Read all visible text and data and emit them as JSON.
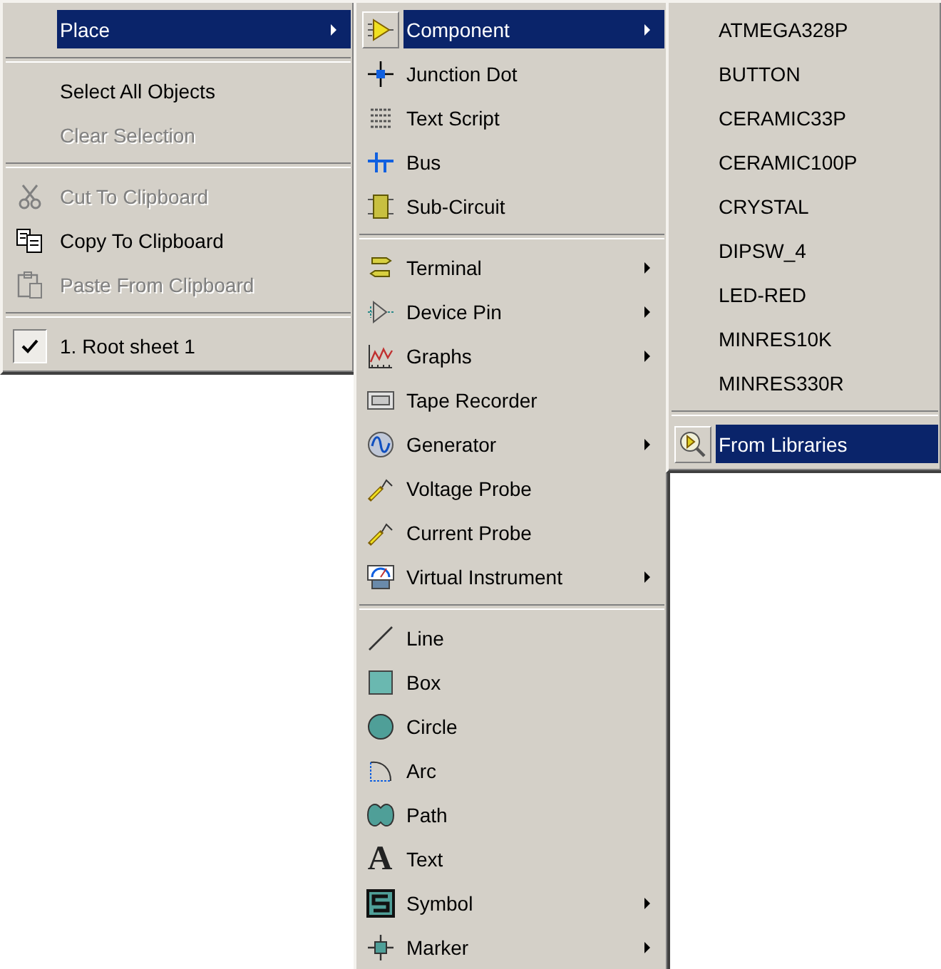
{
  "menus": [
    {
      "items": [
        {
          "kind": "item",
          "label": "Place",
          "selected": true,
          "disabled": false,
          "submenu": true
        },
        {
          "kind": "separator"
        },
        {
          "kind": "item",
          "label": "Select All Objects",
          "selected": false,
          "disabled": false,
          "submenu": false
        },
        {
          "kind": "item",
          "label": "Clear Selection",
          "selected": false,
          "disabled": true,
          "submenu": false
        },
        {
          "kind": "separator"
        },
        {
          "kind": "item",
          "label": "Cut To Clipboard",
          "selected": false,
          "disabled": true,
          "submenu": false
        },
        {
          "kind": "item",
          "label": "Copy To Clipboard",
          "selected": false,
          "disabled": false,
          "submenu": false
        },
        {
          "kind": "item",
          "label": "Paste From Clipboard",
          "selected": false,
          "disabled": true,
          "submenu": false
        },
        {
          "kind": "separator"
        },
        {
          "kind": "item",
          "label": "1. Root sheet 1",
          "selected": false,
          "disabled": false,
          "submenu": false,
          "checked": true
        }
      ]
    },
    {
      "items": [
        {
          "kind": "item",
          "label": "Component",
          "selected": true,
          "disabled": false,
          "submenu": true
        },
        {
          "kind": "item",
          "label": "Junction Dot",
          "selected": false,
          "disabled": false,
          "submenu": false
        },
        {
          "kind": "item",
          "label": "Text Script",
          "selected": false,
          "disabled": false,
          "submenu": false
        },
        {
          "kind": "item",
          "label": "Bus",
          "selected": false,
          "disabled": false,
          "submenu": false
        },
        {
          "kind": "item",
          "label": "Sub-Circuit",
          "selected": false,
          "disabled": false,
          "submenu": false
        },
        {
          "kind": "separator"
        },
        {
          "kind": "item",
          "label": "Terminal",
          "selected": false,
          "disabled": false,
          "submenu": true
        },
        {
          "kind": "item",
          "label": "Device Pin",
          "selected": false,
          "disabled": false,
          "submenu": true
        },
        {
          "kind": "item",
          "label": "Graphs",
          "selected": false,
          "disabled": false,
          "submenu": true
        },
        {
          "kind": "item",
          "label": "Tape Recorder",
          "selected": false,
          "disabled": false,
          "submenu": false
        },
        {
          "kind": "item",
          "label": "Generator",
          "selected": false,
          "disabled": false,
          "submenu": true
        },
        {
          "kind": "item",
          "label": "Voltage Probe",
          "selected": false,
          "disabled": false,
          "submenu": false
        },
        {
          "kind": "item",
          "label": "Current Probe",
          "selected": false,
          "disabled": false,
          "submenu": false
        },
        {
          "kind": "item",
          "label": "Virtual Instrument",
          "selected": false,
          "disabled": false,
          "submenu": true
        },
        {
          "kind": "separator"
        },
        {
          "kind": "item",
          "label": "Line",
          "selected": false,
          "disabled": false,
          "submenu": false
        },
        {
          "kind": "item",
          "label": "Box",
          "selected": false,
          "disabled": false,
          "submenu": false
        },
        {
          "kind": "item",
          "label": "Circle",
          "selected": false,
          "disabled": false,
          "submenu": false
        },
        {
          "kind": "item",
          "label": "Arc",
          "selected": false,
          "disabled": false,
          "submenu": false
        },
        {
          "kind": "item",
          "label": "Path",
          "selected": false,
          "disabled": false,
          "submenu": false
        },
        {
          "kind": "item",
          "label": "Text",
          "selected": false,
          "disabled": false,
          "submenu": false,
          "icon_text": "A"
        },
        {
          "kind": "item",
          "label": "Symbol",
          "selected": false,
          "disabled": false,
          "submenu": true
        },
        {
          "kind": "item",
          "label": "Marker",
          "selected": false,
          "disabled": false,
          "submenu": true
        }
      ]
    },
    {
      "items": [
        {
          "kind": "item",
          "label": "ATMEGA328P",
          "selected": false,
          "disabled": false,
          "submenu": false
        },
        {
          "kind": "item",
          "label": "BUTTON",
          "selected": false,
          "disabled": false,
          "submenu": false
        },
        {
          "kind": "item",
          "label": "CERAMIC33P",
          "selected": false,
          "disabled": false,
          "submenu": false
        },
        {
          "kind": "item",
          "label": "CERAMIC100P",
          "selected": false,
          "disabled": false,
          "submenu": false
        },
        {
          "kind": "item",
          "label": "CRYSTAL",
          "selected": false,
          "disabled": false,
          "submenu": false
        },
        {
          "kind": "item",
          "label": "DIPSW_4",
          "selected": false,
          "disabled": false,
          "submenu": false
        },
        {
          "kind": "item",
          "label": "LED-RED",
          "selected": false,
          "disabled": false,
          "submenu": false
        },
        {
          "kind": "item",
          "label": "MINRES10K",
          "selected": false,
          "disabled": false,
          "submenu": false
        },
        {
          "kind": "item",
          "label": "MINRES330R",
          "selected": false,
          "disabled": false,
          "submenu": false
        },
        {
          "kind": "separator"
        },
        {
          "kind": "item",
          "label": "From Libraries",
          "selected": true,
          "disabled": false,
          "submenu": false
        }
      ]
    }
  ]
}
